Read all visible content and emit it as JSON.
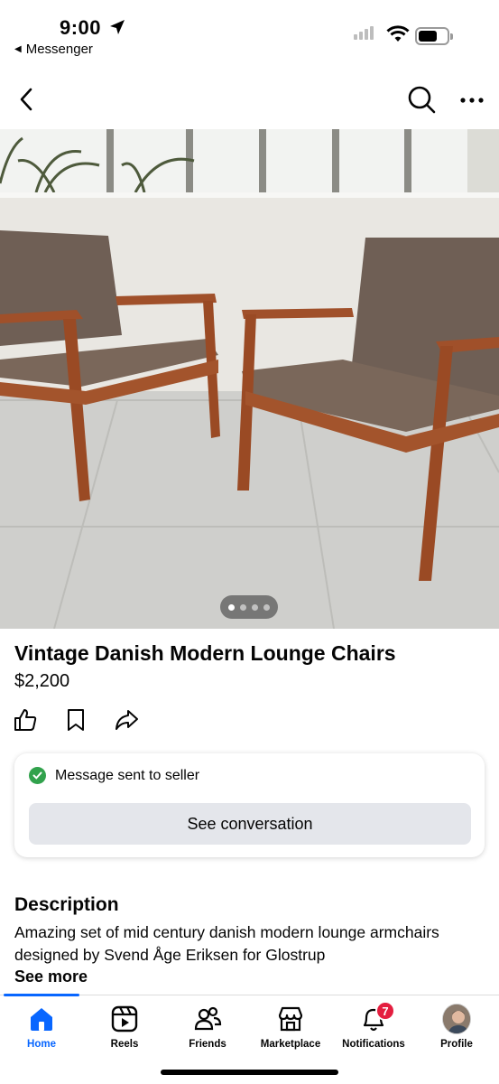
{
  "status_bar": {
    "time": "9:00",
    "back_app": "Messenger"
  },
  "listing": {
    "title": "Vintage Danish Modern Lounge Chairs",
    "price": "$2,200",
    "photo_count": 4,
    "active_photo": 1
  },
  "message_card": {
    "status": "Message sent to seller",
    "button": "See conversation"
  },
  "description": {
    "heading": "Description",
    "text": "Amazing set of mid century danish modern lounge armchairs designed by Svend Åge Eriksen for Glostrup",
    "see_more": "See more"
  },
  "tabs": [
    {
      "label": "Home",
      "icon": "home-icon",
      "active": true
    },
    {
      "label": "Reels",
      "icon": "reels-icon"
    },
    {
      "label": "Friends",
      "icon": "friends-icon"
    },
    {
      "label": "Marketplace",
      "icon": "marketplace-icon"
    },
    {
      "label": "Notifications",
      "icon": "bell-icon",
      "badge": "7"
    },
    {
      "label": "Profile",
      "icon": "avatar"
    }
  ],
  "colors": {
    "accent": "#0866ff",
    "success": "#31a24c",
    "badge": "#e41e3f",
    "button_bg": "#e4e6eb"
  }
}
